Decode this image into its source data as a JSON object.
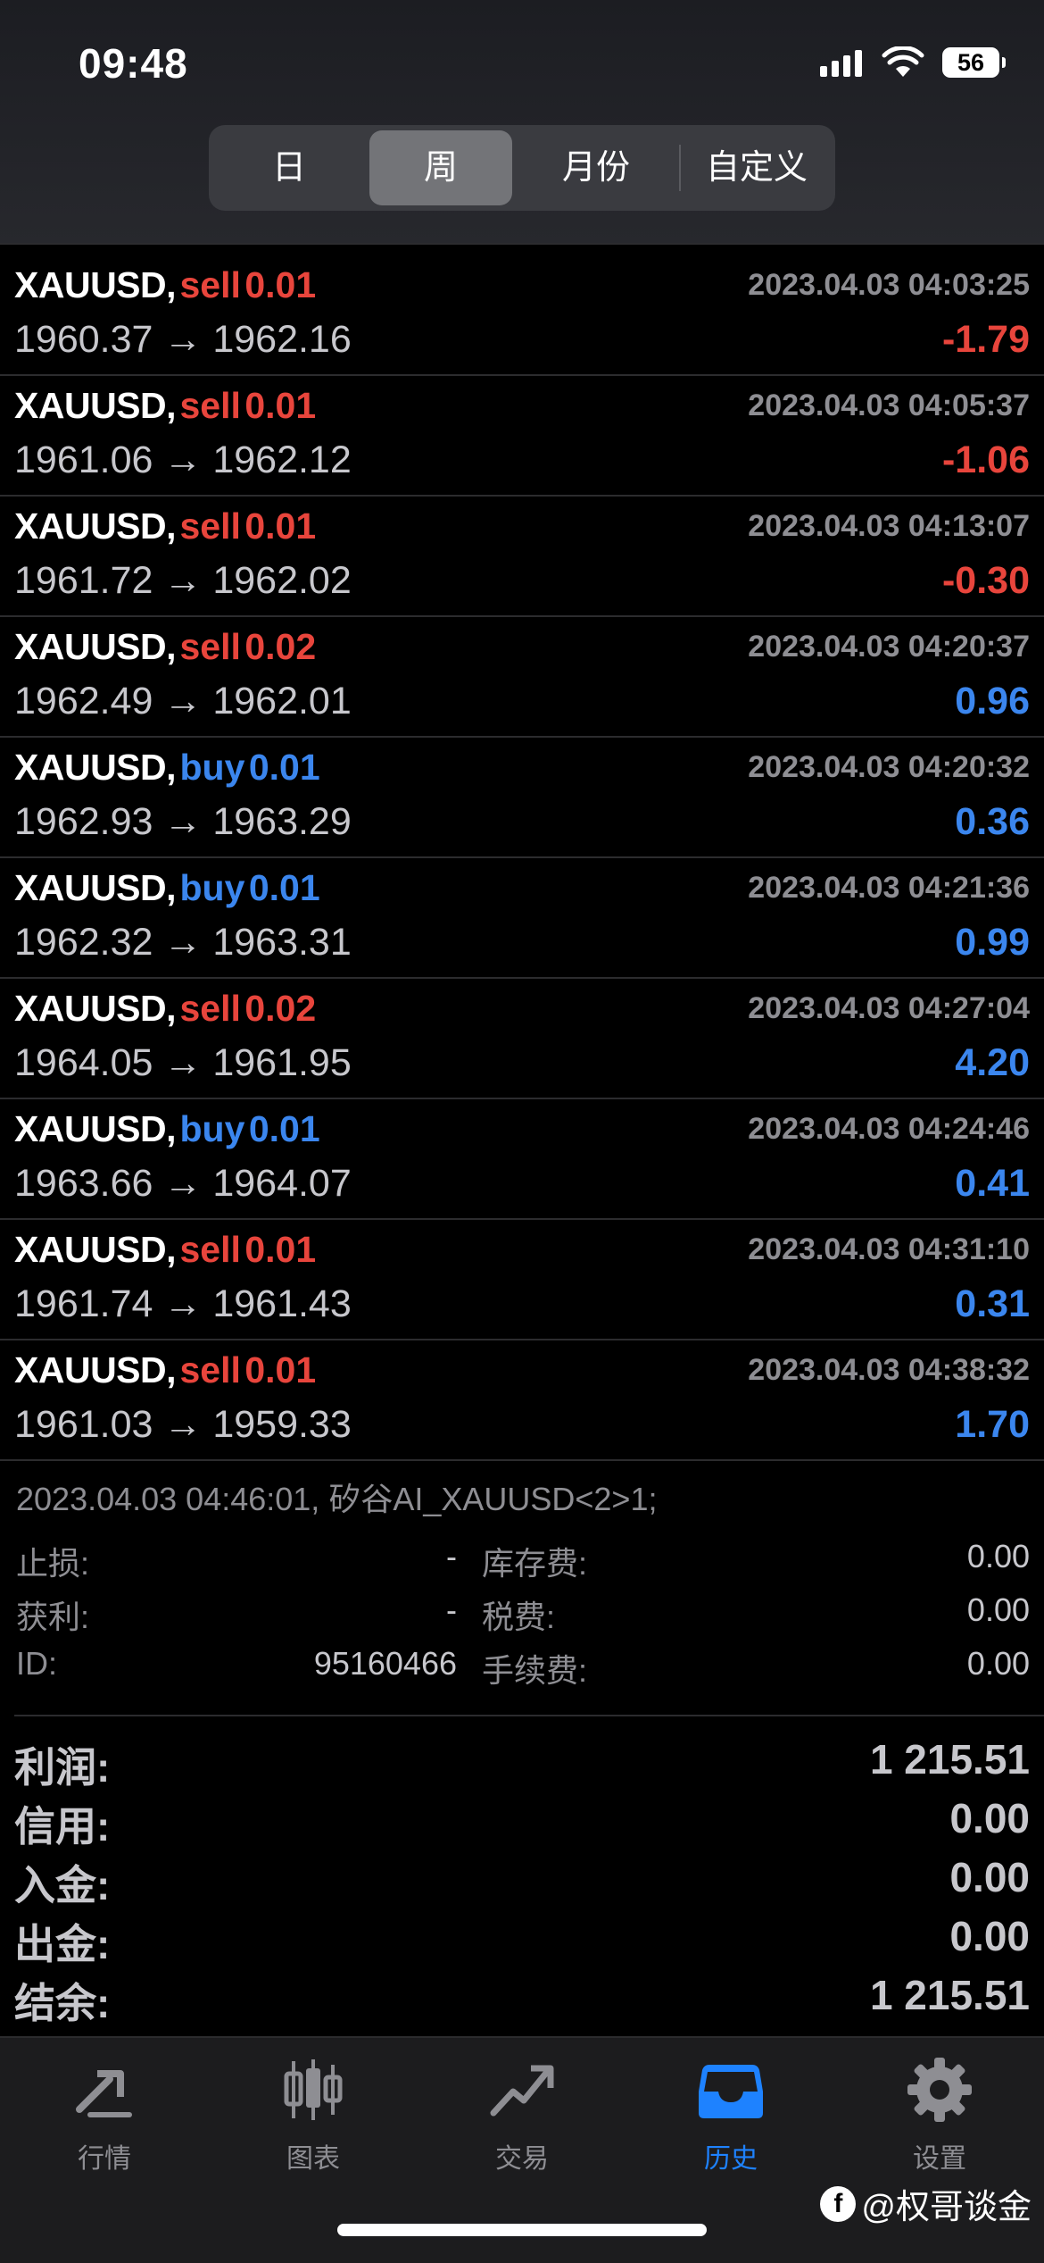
{
  "status_bar": {
    "time": "09:48",
    "battery": "56"
  },
  "period_tabs": [
    {
      "label": "日"
    },
    {
      "label": "周",
      "active": true
    },
    {
      "label": "月份"
    },
    {
      "label": "自定义"
    }
  ],
  "trades": [
    {
      "symbol": "XAUUSD,",
      "side": "sell",
      "volume": "0.01",
      "timestamp": "2023.04.03 04:03:25",
      "prices": "1960.37 → 1962.16",
      "profit": "-1.79"
    },
    {
      "symbol": "XAUUSD,",
      "side": "sell",
      "volume": "0.01",
      "timestamp": "2023.04.03 04:05:37",
      "prices": "1961.06 → 1962.12",
      "profit": "-1.06"
    },
    {
      "symbol": "XAUUSD,",
      "side": "sell",
      "volume": "0.01",
      "timestamp": "2023.04.03 04:13:07",
      "prices": "1961.72 → 1962.02",
      "profit": "-0.30"
    },
    {
      "symbol": "XAUUSD,",
      "side": "sell",
      "volume": "0.02",
      "timestamp": "2023.04.03 04:20:37",
      "prices": "1962.49 → 1962.01",
      "profit": "0.96"
    },
    {
      "symbol": "XAUUSD,",
      "side": "buy",
      "volume": "0.01",
      "timestamp": "2023.04.03 04:20:32",
      "prices": "1962.93 → 1963.29",
      "profit": "0.36"
    },
    {
      "symbol": "XAUUSD,",
      "side": "buy",
      "volume": "0.01",
      "timestamp": "2023.04.03 04:21:36",
      "prices": "1962.32 → 1963.31",
      "profit": "0.99"
    },
    {
      "symbol": "XAUUSD,",
      "side": "sell",
      "volume": "0.02",
      "timestamp": "2023.04.03 04:27:04",
      "prices": "1964.05 → 1961.95",
      "profit": "4.20"
    },
    {
      "symbol": "XAUUSD,",
      "side": "buy",
      "volume": "0.01",
      "timestamp": "2023.04.03 04:24:46",
      "prices": "1963.66 → 1964.07",
      "profit": "0.41"
    },
    {
      "symbol": "XAUUSD,",
      "side": "sell",
      "volume": "0.01",
      "timestamp": "2023.04.03 04:31:10",
      "prices": "1961.74 → 1961.43",
      "profit": "0.31"
    },
    {
      "symbol": "XAUUSD,",
      "side": "sell",
      "volume": "0.01",
      "timestamp": "2023.04.03 04:38:32",
      "prices": "1961.03 → 1959.33",
      "profit": "1.70"
    }
  ],
  "expanded_detail": {
    "title": "2023.04.03 04:46:01, 矽谷AI_XAUUSD<2>1;",
    "stop_loss_label": "止损:",
    "stop_loss_value": "-",
    "take_profit_label": "获利:",
    "take_profit_value": "-",
    "id_label": "ID:",
    "id_value": "95160466",
    "swap_label": "库存费:",
    "swap_value": "0.00",
    "tax_label": "税费:",
    "tax_value": "0.00",
    "commission_label": "手续费:",
    "commission_value": "0.00"
  },
  "summary": [
    {
      "label": "利润:",
      "value": "1 215.51"
    },
    {
      "label": "信用:",
      "value": "0.00"
    },
    {
      "label": "入金:",
      "value": "0.00"
    },
    {
      "label": "出金:",
      "value": "0.00"
    },
    {
      "label": "结余:",
      "value": "1 215.51"
    }
  ],
  "tabbar": [
    {
      "label": "行情",
      "icon": "quotes-arrows-icon"
    },
    {
      "label": "图表",
      "icon": "candlestick-chart-icon"
    },
    {
      "label": "交易",
      "icon": "trade-trend-icon"
    },
    {
      "label": "历史",
      "icon": "history-inbox-icon",
      "active": true
    },
    {
      "label": "设置",
      "icon": "gear-icon"
    }
  ],
  "watermark": {
    "text": "@权哥谈金",
    "icon_letter": "f"
  },
  "colors": {
    "sell": "#e8453c",
    "buy": "#3b86ee",
    "active_tab": "#1e82ff",
    "muted": "#8e8e93"
  }
}
